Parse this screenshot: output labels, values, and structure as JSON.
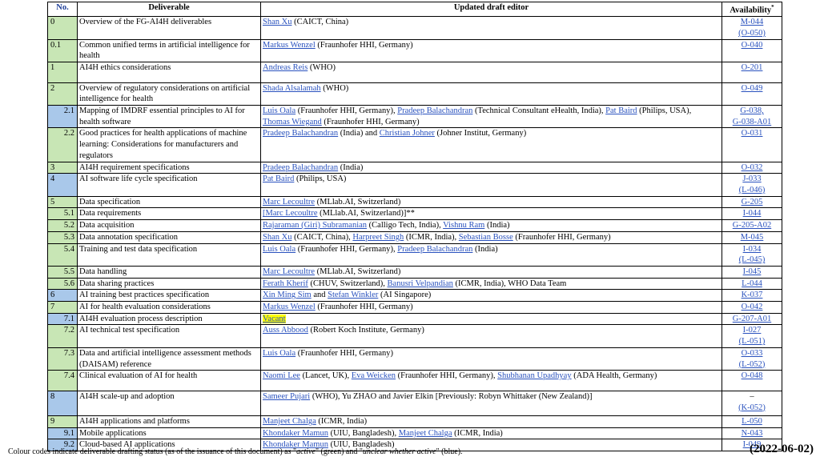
{
  "columns": {
    "no": "No.",
    "deliverable": "Deliverable",
    "editor": "Updated draft editor",
    "availability": "Availability",
    "availability_mark": "*"
  },
  "rows": [
    {
      "no": "0",
      "sub": false,
      "status": "green",
      "deliverable": "Overview of the FG-AI4H deliverables",
      "editor": [
        {
          "t": "Shan Xu",
          "link": true
        },
        {
          "t": " (CAICT, China)"
        }
      ],
      "avail": [
        "M-044",
        "(O-050)"
      ],
      "lines": 2
    },
    {
      "no": "0.1",
      "sub": false,
      "status": "green",
      "deliverable": "Common unified terms in artificial intelligence for health",
      "editor": [
        {
          "t": "Markus Wenzel",
          "link": true
        },
        {
          "t": " (Fraunhofer HHI, Germany)"
        }
      ],
      "avail": [
        "O-040"
      ],
      "lines": 2
    },
    {
      "no": "1",
      "sub": false,
      "status": "green",
      "deliverable": "AI4H ethics considerations",
      "editor": [
        {
          "t": "Andreas Reis",
          "link": true
        },
        {
          "t": " (WHO)"
        }
      ],
      "avail": [
        "O-201"
      ],
      "lines": 1.8
    },
    {
      "no": "2",
      "sub": false,
      "status": "green",
      "deliverable": "Overview of regulatory considerations on artificial intelligence for health",
      "editor": [
        {
          "t": "Shada Alsalamah",
          "link": true
        },
        {
          "t": " (WHO)"
        }
      ],
      "avail": [
        "O-049"
      ],
      "lines": 2
    },
    {
      "no": "2.1",
      "sub": true,
      "status": "blue",
      "deliverable": "Mapping of IMDRF essential principles to AI for health software",
      "editor": [
        {
          "t": "Luis Oala",
          "link": true
        },
        {
          "t": " (Fraunhofer HHI, Germany), "
        },
        {
          "t": "Pradeep Balachandran",
          "link": true
        },
        {
          "t": " (Technical Consultant eHealth, India), "
        },
        {
          "t": "Pat Baird",
          "link": true
        },
        {
          "t": " (Philips, USA), "
        },
        {
          "t": "Thomas Wiegand",
          "link": true
        },
        {
          "t": " (Fraunhofer HHI, Germany)"
        }
      ],
      "avail": [
        "G-038,",
        "G-038-A01"
      ],
      "lines": 2
    },
    {
      "no": "2.2",
      "sub": true,
      "status": "green",
      "deliverable": "Good practices for health applications of machine learning: Considerations for manufacturers and regulators",
      "editor": [
        {
          "t": "Pradeep Balachandran",
          "link": true
        },
        {
          "t": " (India) and "
        },
        {
          "t": "Christian Johner",
          "link": true
        },
        {
          "t": " (Johner Institut, Germany)"
        }
      ],
      "avail": [
        "O-031"
      ],
      "lines": 3
    },
    {
      "no": "3",
      "sub": false,
      "status": "green",
      "deliverable": "AI4H requirement specifications",
      "editor": [
        {
          "t": "Pradeep Balachandran",
          "link": true
        },
        {
          "t": " (India)"
        }
      ],
      "avail": [
        "O-032"
      ],
      "lines": 1
    },
    {
      "no": "4",
      "sub": false,
      "status": "blue",
      "deliverable": "AI software life cycle specification",
      "editor": [
        {
          "t": "Pat Baird",
          "link": true
        },
        {
          "t": " (Philips, USA)"
        }
      ],
      "avail": [
        "J-033",
        "(L-046)"
      ],
      "lines": 2
    },
    {
      "no": "5",
      "sub": false,
      "status": "green",
      "deliverable": "Data specification",
      "editor": [
        {
          "t": "Marc Lecoultre",
          "link": true
        },
        {
          "t": " (MLlab.AI, Switzerland)"
        }
      ],
      "avail": [
        "G-205"
      ],
      "lines": 1
    },
    {
      "no": "5.1",
      "sub": true,
      "status": "green",
      "deliverable": "Data requirements",
      "editor": [
        {
          "t": "[",
          "link": true
        },
        {
          "t": "Marc Lecoultre",
          "link": true
        },
        {
          "t": " (MLlab.AI, Switzerland)]**"
        }
      ],
      "avail": [
        "I-044"
      ],
      "lines": 1
    },
    {
      "no": "5.2",
      "sub": true,
      "status": "green",
      "deliverable": "Data acquisition",
      "editor": [
        {
          "t": "Rajaraman (Giri) Subramanian",
          "link": true
        },
        {
          "t": " (Calligo Tech, India), "
        },
        {
          "t": "Vishnu Ram",
          "link": true
        },
        {
          "t": " (India)"
        }
      ],
      "avail": [
        "G-205-A02"
      ],
      "lines": 1
    },
    {
      "no": "5.3",
      "sub": true,
      "status": "green",
      "deliverable": "Data annotation specification",
      "editor": [
        {
          "t": "Shan Xu",
          "link": true
        },
        {
          "t": " (CAICT, China), "
        },
        {
          "t": "Harpreet Singh",
          "link": true
        },
        {
          "t": " (ICMR, India), "
        },
        {
          "t": "Sebastian Bosse",
          "link": true
        },
        {
          "t": " (Fraunhofer HHI, Germany)"
        }
      ],
      "avail": [
        "M-045"
      ],
      "lines": 1
    },
    {
      "no": "5.4",
      "sub": true,
      "status": "green",
      "deliverable": "Training and test data specification",
      "editor": [
        {
          "t": "Luis Oala",
          "link": true
        },
        {
          "t": " (Fraunhofer HHI, Germany), "
        },
        {
          "t": "Pradeep Balachandran",
          "link": true
        },
        {
          "t": " (India)"
        }
      ],
      "avail": [
        "I-034",
        "(L-045)"
      ],
      "lines": 2
    },
    {
      "no": "5.5",
      "sub": true,
      "status": "green",
      "deliverable": "Data handling",
      "editor": [
        {
          "t": "Marc Lecoultre",
          "link": true
        },
        {
          "t": " (MLlab.AI, Switzerland)"
        }
      ],
      "avail": [
        "I-045"
      ],
      "lines": 1
    },
    {
      "no": "5.6",
      "sub": true,
      "status": "green",
      "deliverable": "Data sharing practices",
      "editor": [
        {
          "t": "Ferath Kherif",
          "link": true
        },
        {
          "t": " (CHUV, Switzerland), "
        },
        {
          "t": "Banusri Velpandian",
          "link": true
        },
        {
          "t": " (ICMR, India), WHO Data Team"
        }
      ],
      "avail": [
        "L-044"
      ],
      "lines": 1
    },
    {
      "no": "6",
      "sub": false,
      "status": "blue",
      "deliverable": "AI training best practices specification",
      "editor": [
        {
          "t": "Xin Ming Sim",
          "link": true
        },
        {
          "t": " and "
        },
        {
          "t": "Stefan Winkler",
          "link": true
        },
        {
          "t": " (AI Singapore)"
        }
      ],
      "avail": [
        "K-037"
      ],
      "lines": 1
    },
    {
      "no": "7",
      "sub": false,
      "status": "green",
      "deliverable": "AI for health evaluation considerations",
      "editor": [
        {
          "t": "Markus Wenzel",
          "link": true
        },
        {
          "t": " (Fraunhofer HHI, Germany)"
        }
      ],
      "avail": [
        "O-042"
      ],
      "lines": 1
    },
    {
      "no": "7.1",
      "sub": true,
      "status": "blue",
      "deliverable": "AI4H evaluation process description",
      "editor": [
        {
          "t": "Vacant",
          "link": true,
          "hl": true
        }
      ],
      "avail": [
        "G-207-A01"
      ],
      "lines": 1
    },
    {
      "no": "7.2",
      "sub": true,
      "status": "green",
      "deliverable": "AI technical test specification",
      "editor": [
        {
          "t": "Auss Abbood",
          "link": true
        },
        {
          "t": " (Robert Koch Institute, Germany)"
        }
      ],
      "avail": [
        "I-027",
        "(L-051)"
      ],
      "lines": 2
    },
    {
      "no": "7.3",
      "sub": true,
      "status": "green",
      "deliverable": "Data and artificial intelligence assessment methods (DAISAM) reference",
      "editor": [
        {
          "t": "Luis Oala",
          "link": true
        },
        {
          "t": " (Fraunhofer HHI, Germany)"
        }
      ],
      "avail": [
        "O-033",
        "(L-052)"
      ],
      "lines": 2
    },
    {
      "no": "7.4",
      "sub": true,
      "status": "green",
      "deliverable": "Clinical evaluation of AI for health",
      "editor": [
        {
          "t": "Naomi Lee",
          "link": true
        },
        {
          "t": " (Lancet, UK), "
        },
        {
          "t": "Eva Weicken",
          "link": true
        },
        {
          "t": " (Fraunhofer HHI, Germany), "
        },
        {
          "t": "Shubhanan Upadhyay",
          "link": true
        },
        {
          "t": " (ADA Health, Germany)"
        }
      ],
      "avail": [
        "O-048"
      ],
      "lines": 1.8
    },
    {
      "no": "8",
      "sub": false,
      "status": "blue",
      "deliverable": "AI4H scale-up and adoption",
      "editor": [
        {
          "t": "Sameer Pujari",
          "link": true
        },
        {
          "t": " (WHO), Yu ZHAO and Javier Elkin [Previously: Robyn Whittaker (New Zealand)]"
        }
      ],
      "avail": [
        "–",
        "(K-052)"
      ],
      "lines": 2.2
    },
    {
      "no": "9",
      "sub": false,
      "status": "green",
      "deliverable": "AI4H applications and platforms",
      "editor": [
        {
          "t": "Manjeet Chalga",
          "link": true
        },
        {
          "t": " (ICMR, India)"
        }
      ],
      "avail": [
        "L-050"
      ],
      "lines": 1
    },
    {
      "no": "9.1",
      "sub": true,
      "status": "blue",
      "deliverable": "Mobile applications",
      "editor": [
        {
          "t": "Khondaker Mamun",
          "link": true
        },
        {
          "t": " (UIU, Bangladesh), "
        },
        {
          "t": "Manjeet Chalga",
          "link": true
        },
        {
          "t": " (ICMR, India)"
        }
      ],
      "avail": [
        "N-043"
      ],
      "lines": 1
    },
    {
      "no": "9.2",
      "sub": true,
      "status": "blue",
      "deliverable": "Cloud-based AI applications",
      "editor": [
        {
          "t": "Khondaker Mamun",
          "link": true
        },
        {
          "t": " (UIU, Bangladesh)"
        }
      ],
      "avail": [
        "I-049"
      ],
      "lines": 1
    }
  ],
  "status_colors": {
    "green": "#c8e6b5",
    "blue": "#a9c8ea"
  },
  "footnote": {
    "p1": "Colour codes indicate deliverable drafting status (as of the issuance of this document) as \"",
    "active": "active",
    "p2": "\" (green) and \"",
    "unclear": "unclear whether active",
    "p3": "\" (blue)."
  },
  "date": "(2022-06-02)"
}
